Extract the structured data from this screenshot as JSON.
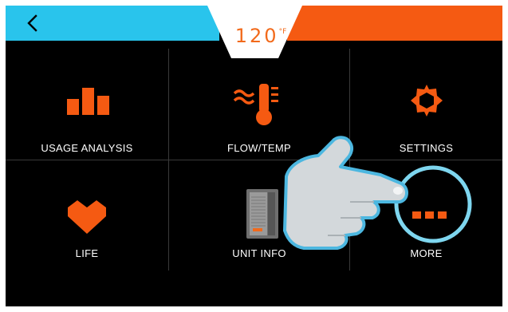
{
  "header": {
    "temperature_value": "120",
    "temperature_unit": "°F",
    "back_icon": "chevron-left-icon",
    "colors": {
      "left_bar": "#29c4ec",
      "right_bar": "#f55a12",
      "accent": "#f26a1b"
    }
  },
  "menu": {
    "tiles": [
      {
        "label": "USAGE ANALYSIS",
        "icon": "bar-chart-icon"
      },
      {
        "label": "FLOW/TEMP",
        "icon": "thermometer-flow-icon"
      },
      {
        "label": "SETTINGS",
        "icon": "hexagon-gear-icon"
      },
      {
        "label": "LIFE",
        "icon": "heart-icon"
      },
      {
        "label": "UNIT INFO",
        "icon": "water-heater-unit-icon"
      },
      {
        "label": "MORE",
        "icon": "ellipsis-icon"
      }
    ]
  },
  "overlay": {
    "icon": "pointing-hand-icon",
    "highlight": "more-button-circle"
  }
}
